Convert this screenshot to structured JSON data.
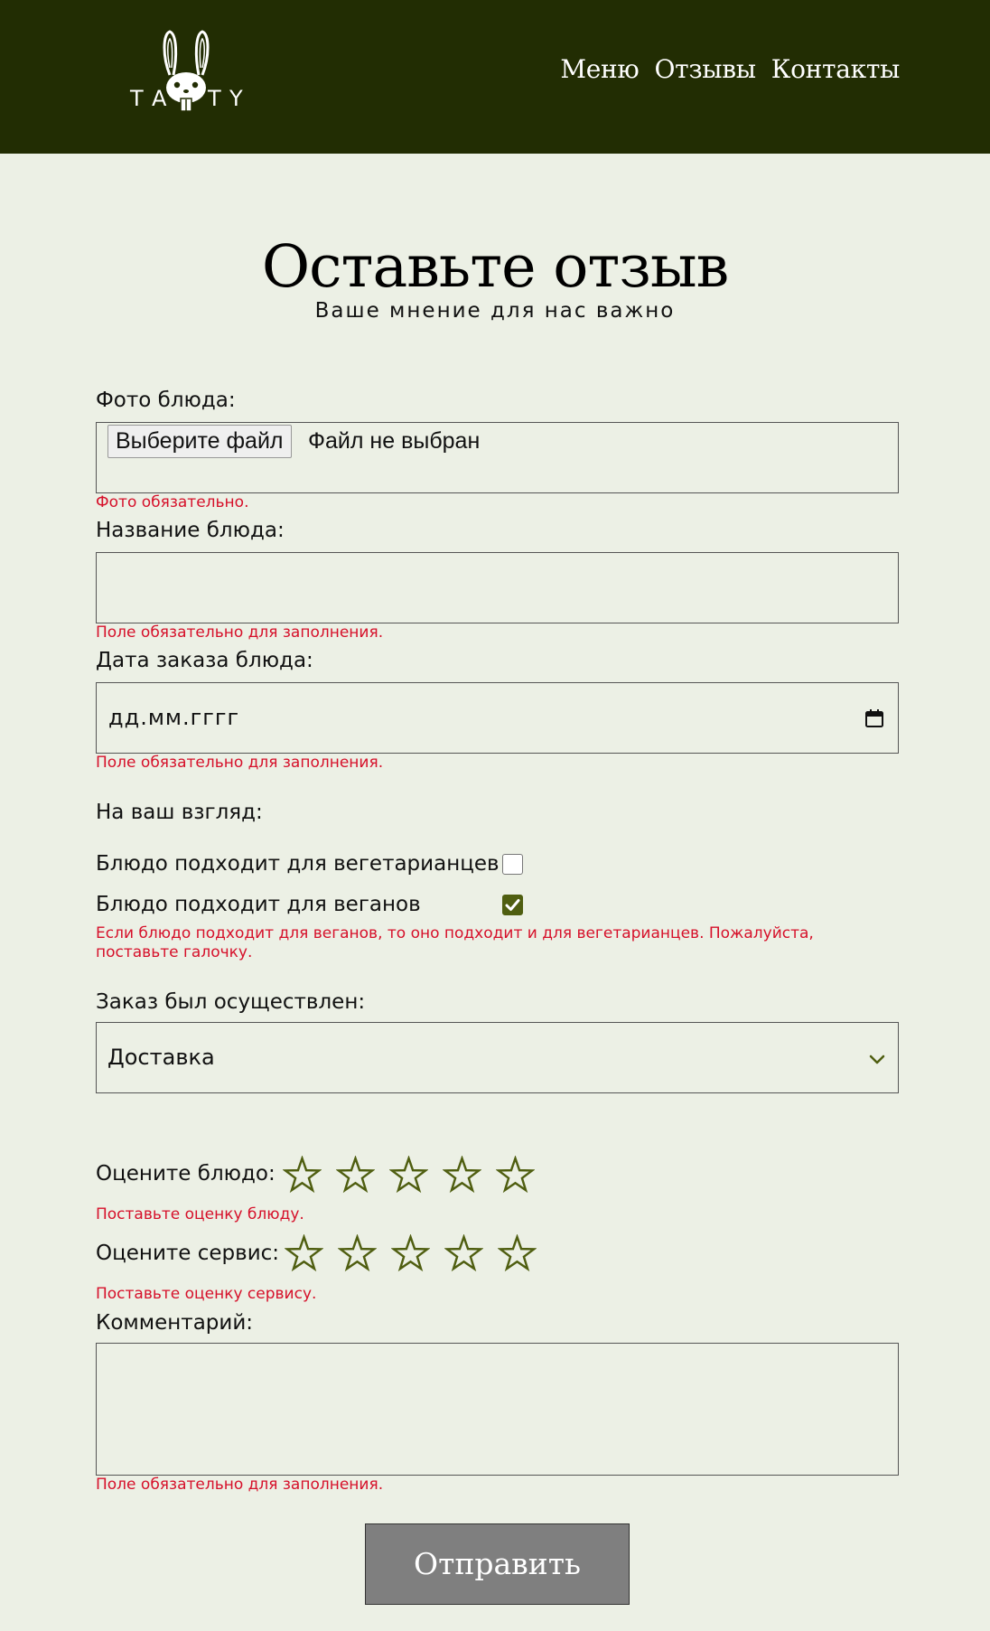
{
  "header": {
    "logo_text": "TASTY",
    "nav": [
      "Меню",
      "Отзывы",
      "Контакты"
    ]
  },
  "page": {
    "title": "Оставьте отзыв",
    "subtitle": "Ваше мнение для нас важно"
  },
  "form": {
    "photo": {
      "label": "Фото блюда:",
      "button": "Выберите файл",
      "status": "Файл не выбран",
      "error": "Фото обязательно."
    },
    "dish_name": {
      "label": "Название блюда:",
      "value": "",
      "error": "Поле обязательно для заполнения."
    },
    "order_date": {
      "label": "Дата заказа блюда:",
      "placeholder": "дд.мм.гггг",
      "error": "Поле обязательно для заполнения."
    },
    "opinion": {
      "label": "На ваш взгляд:",
      "vegetarian_label": "Блюдо подходит для вегетарианцев",
      "vegetarian_checked": false,
      "vegan_label": "Блюдо подходит для веганов",
      "vegan_checked": true,
      "error": "Если блюдо подходит для веганов, то оно подходит и для вегетарианцев. Пожалуйста, поставьте галочку."
    },
    "order_type": {
      "label": "Заказ был осуществлен:",
      "selected": "Доставка"
    },
    "dish_rating": {
      "label": "Оцените блюдо:",
      "value": 0,
      "max": 5,
      "error": "Поставьте оценку блюду."
    },
    "service_rating": {
      "label": "Оцените сервис:",
      "value": 0,
      "max": 5,
      "error": "Поставьте оценку сервису."
    },
    "comment": {
      "label": "Комментарий:",
      "value": "",
      "error": "Поле обязательно для заполнения."
    },
    "submit_label": "Отправить"
  },
  "colors": {
    "header_bg": "#222D03",
    "page_bg": "#ECF0E5",
    "accent": "#4F5E10",
    "error": "#D6102A",
    "submit_bg": "#7F7F7F"
  },
  "icons": [
    "logo-rabbit-icon",
    "calendar-icon",
    "checkmark-icon",
    "chevron-down-icon",
    "star-outline-icon"
  ]
}
